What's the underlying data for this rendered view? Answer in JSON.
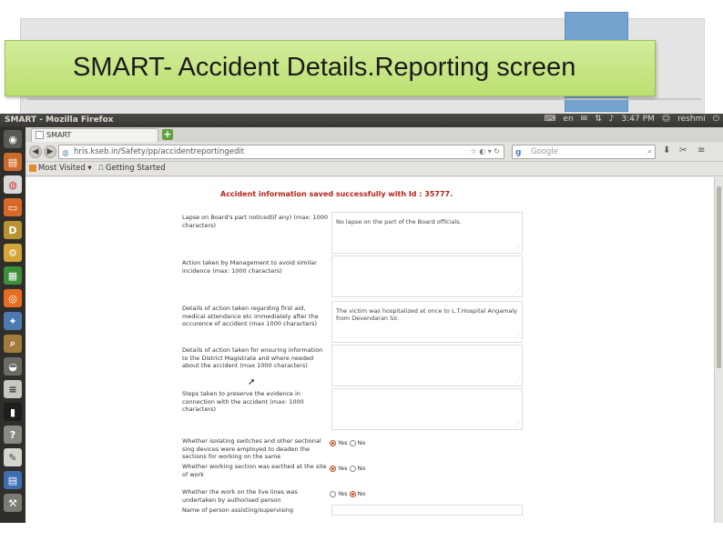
{
  "slide": {
    "title": "SMART- Accident Details.Reporting screen"
  },
  "window": {
    "title": "SMART - Mozilla Firefox"
  },
  "indicators": {
    "lang": "en",
    "time": "3:47 PM",
    "user": "reshmi"
  },
  "browser": {
    "tab_label": "SMART",
    "url": "hris.kseb.in/Safety/pp/accidentreportingedit",
    "search_placeholder": "Google",
    "bookmarks": [
      "Most Visited ▾",
      "Getting Started"
    ]
  },
  "form": {
    "success_message": "Accident information saved successfully with Id : 35777.",
    "text_fields": [
      {
        "label": "Lapse on Board's part noticed(if any) (max: 1000 characters)",
        "value": "No lapse on the part of the Board officials."
      },
      {
        "label": "Action taken by Management to avoid similar incidence (max: 1000 characters)",
        "value": ""
      },
      {
        "label": "Details of action taken regarding first aid, medical attendance etc immediately after the occurence of accident (max 1000 characters)",
        "value": "The victim was hospitalized at once to L.T.Hospital Angamaly from Devendaran Sir."
      },
      {
        "label": "Details of action taken for ensuring information to the District Magistrate and where needed about the accident (max 1000 characters)",
        "value": ""
      },
      {
        "label": "Steps taken to preserve the evidence in connection with the accident (max: 1000 characters)",
        "value": ""
      }
    ],
    "radio_fields": [
      {
        "label": "Whether isolating switches and other sectional sing devices were employed to deaden the sections for working on the same",
        "yes": "Yes",
        "no": "No",
        "selected": "yes"
      },
      {
        "label": "Whether working section was earthed at the site of work",
        "yes": "Yes",
        "no": "No",
        "selected": "yes"
      },
      {
        "label": "Whether the work on the live lines was undertaken by authorised person",
        "yes": "Yes",
        "no": "No",
        "selected": "no"
      }
    ],
    "last_label": "Name of person assisting/supervising"
  },
  "colors": {
    "title_green": "#c7e587",
    "accent_blue": "#74a3cf",
    "success_red": "#b42318",
    "radio_orange": "#d95b2a"
  }
}
